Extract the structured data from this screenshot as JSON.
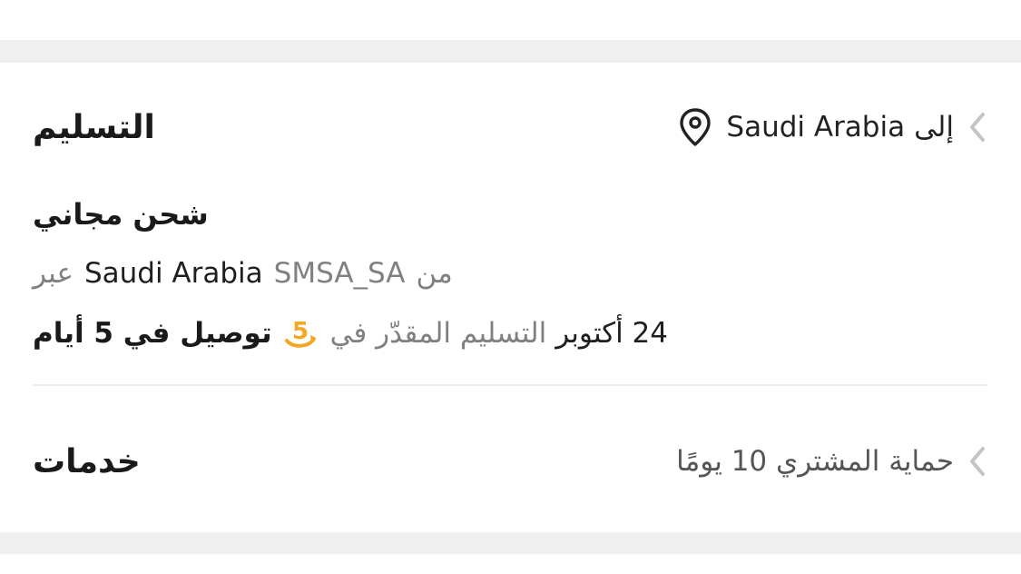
{
  "delivery": {
    "title": "التسليم",
    "destination_prefix": "إلى",
    "destination_country": "Saudi Arabia",
    "shipping_title": "شحن مجاني",
    "via_prefix": "عبر",
    "via_country": "Saudi Arabia",
    "carrier": "SMSA_SA",
    "from_word": "من",
    "eta_bold": "توصيل في 5 أيام",
    "eta_mid": "التسليم المقدّر في",
    "eta_date": "24 أكتوبر"
  },
  "services": {
    "title": "خدمات",
    "protection": "حماية المشتري 10 يومًا"
  },
  "colors": {
    "badge": "#f5a623",
    "chevron": "#c4c4c4"
  }
}
